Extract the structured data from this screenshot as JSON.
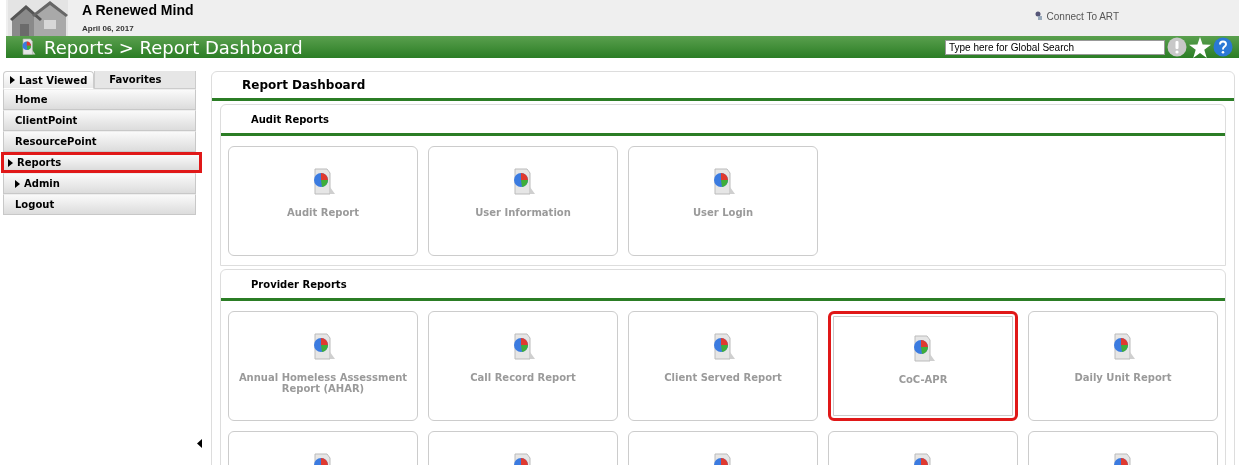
{
  "header": {
    "org_name": "A Renewed Mind",
    "date": "April 06, 2017",
    "connect_link": "Connect To ART"
  },
  "title_bar": {
    "breadcrumb": "Reports > Report Dashboard",
    "search": {
      "placeholder": "Type here for Global Search"
    }
  },
  "sidebar": {
    "tabs": [
      {
        "label": "Last Viewed",
        "selected": true
      },
      {
        "label": "Favorites",
        "selected": false
      }
    ],
    "items": [
      {
        "label": "Home",
        "expandable": false,
        "highlighted": false
      },
      {
        "label": "ClientPoint",
        "expandable": false,
        "highlighted": false
      },
      {
        "label": "ResourcePoint",
        "expandable": false,
        "highlighted": false
      },
      {
        "label": "Reports",
        "expandable": true,
        "highlighted": true
      },
      {
        "label": "Admin",
        "expandable": true,
        "highlighted": false
      },
      {
        "label": "Logout",
        "expandable": false,
        "highlighted": false
      }
    ]
  },
  "dashboard": {
    "title": "Report Dashboard",
    "sections": [
      {
        "title": "Audit Reports",
        "tiles": [
          {
            "label": "Audit Report",
            "highlighted": false
          },
          {
            "label": "User Information",
            "highlighted": false
          },
          {
            "label": "User Login",
            "highlighted": false
          }
        ]
      },
      {
        "title": "Provider Reports",
        "tiles": [
          {
            "label": "Annual Homeless Assessment Report (AHAR)",
            "highlighted": false
          },
          {
            "label": "Call Record Report",
            "highlighted": false
          },
          {
            "label": "Client Served Report",
            "highlighted": false
          },
          {
            "label": "CoC-APR",
            "highlighted": true
          },
          {
            "label": "Daily Unit Report",
            "highlighted": false
          },
          {
            "highlighted": false
          },
          {
            "highlighted": false
          },
          {
            "highlighted": false
          },
          {
            "highlighted": false
          },
          {
            "highlighted": false
          }
        ]
      }
    ]
  }
}
